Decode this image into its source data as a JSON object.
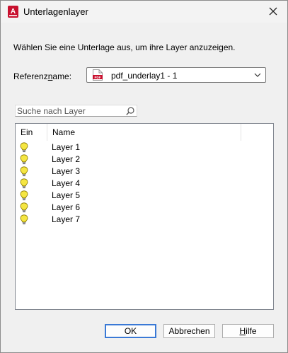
{
  "window": {
    "title": "Unterlagenlayer"
  },
  "instruction": "Wählen Sie eine Unterlage aus, um ihre Layer anzuzeigen.",
  "reference": {
    "label_pre": "Referenz",
    "label_mnemonic": "n",
    "label_post": "ame:",
    "value": "pdf_underlay1 - 1"
  },
  "search": {
    "placeholder": "Suche nach Layer"
  },
  "table": {
    "columns": [
      "Ein",
      "Name"
    ],
    "rows": [
      {
        "on": true,
        "name": "Layer 1"
      },
      {
        "on": true,
        "name": "Layer 2"
      },
      {
        "on": true,
        "name": "Layer 3"
      },
      {
        "on": true,
        "name": "Layer 4"
      },
      {
        "on": true,
        "name": "Layer 5"
      },
      {
        "on": true,
        "name": "Layer 6"
      },
      {
        "on": true,
        "name": "Layer 7"
      }
    ]
  },
  "buttons": {
    "ok": "OK",
    "cancel": "Abbrechen",
    "help_mnemonic": "H",
    "help_rest": "ilfe"
  },
  "colors": {
    "accent": "#3a79d6",
    "app_icon": "#c8102e",
    "bulb": "#f5e642"
  },
  "icons": {
    "app": "autocad-app-icon",
    "close": "close-icon",
    "pdf": "pdf-file-icon",
    "dropdown": "chevron-down-icon",
    "search": "search-icon",
    "layer_on": "lightbulb-on-icon"
  }
}
